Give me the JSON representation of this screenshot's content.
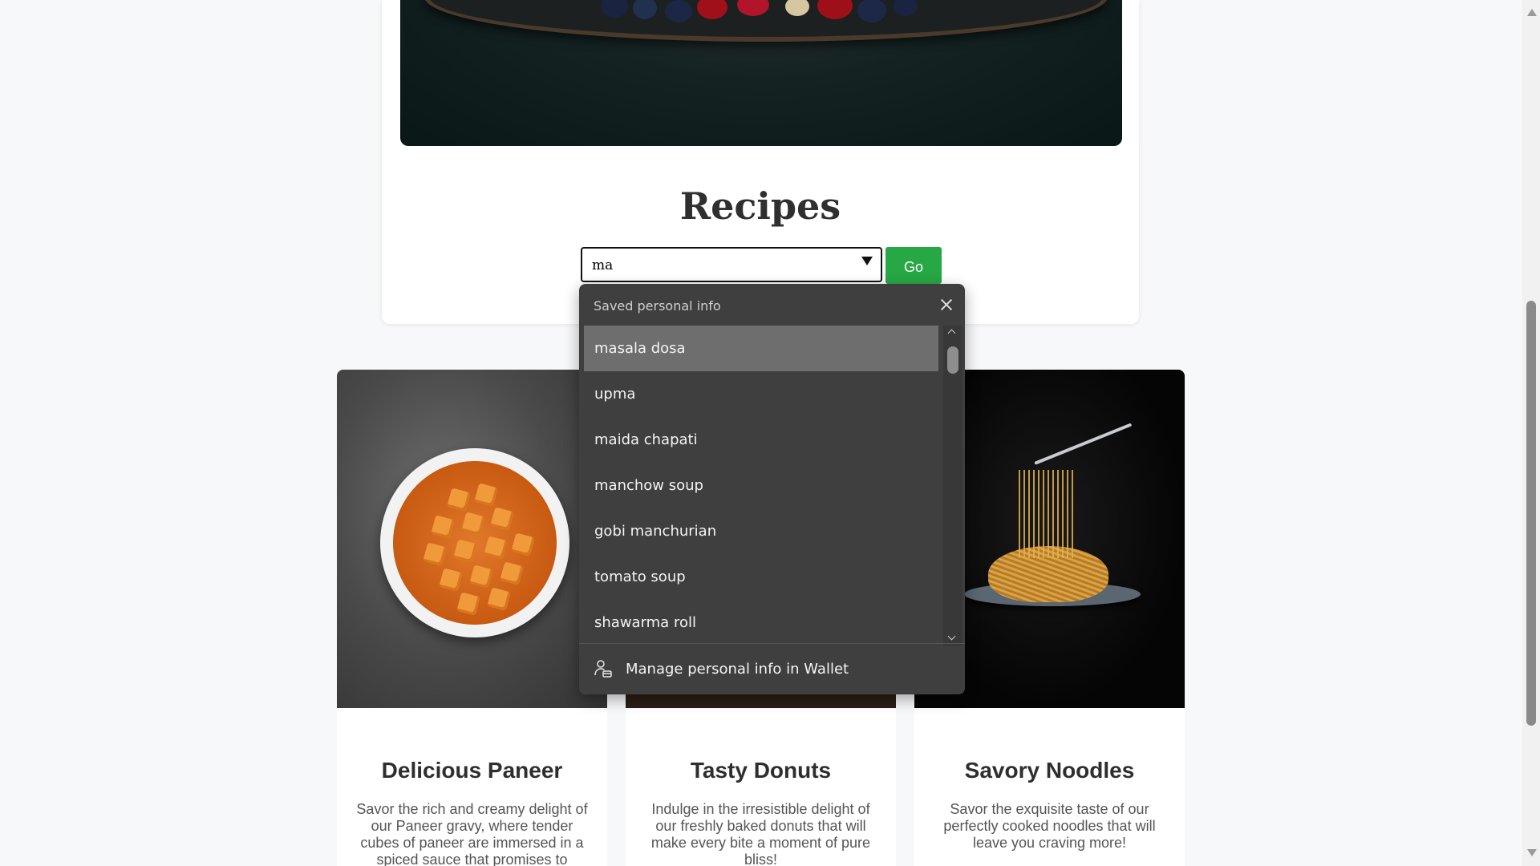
{
  "page": {
    "title": "Recipes"
  },
  "search": {
    "value": "ma",
    "go_label": "Go"
  },
  "autofill": {
    "header": "Saved personal info",
    "items": [
      {
        "label": "masala dosa"
      },
      {
        "label": "upma"
      },
      {
        "label": "maida chapati"
      },
      {
        "label": "manchow soup"
      },
      {
        "label": "gobi manchurian"
      },
      {
        "label": "tomato soup"
      },
      {
        "label": "shawarma roll"
      }
    ],
    "footer_label": "Manage personal info in Wallet"
  },
  "cards": [
    {
      "title": "Delicious Paneer",
      "description": "Savor the rich and creamy delight of our Paneer gravy, where tender cubes of paneer are immersed in a spiced sauce that promises to"
    },
    {
      "title": "Tasty Donuts",
      "description": "Indulge in the irresistible delight of our freshly baked donuts that will make every bite a moment of pure bliss!"
    },
    {
      "title": "Savory Noodles",
      "description": "Savor the exquisite taste of our perfectly cooked noodles that will leave you craving more!"
    }
  ],
  "colors": {
    "go_button": "#28a745",
    "autofill_bg": "#3f3f3f",
    "autofill_selected": "#6e6e6e",
    "page_bg": "#f7f8f9"
  }
}
